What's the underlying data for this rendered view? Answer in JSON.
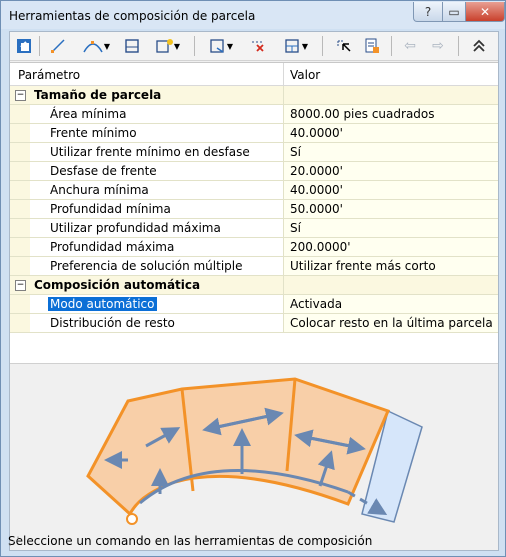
{
  "window": {
    "title": "Herramientas de composición de parcela"
  },
  "grid": {
    "col_param": "Parámetro",
    "col_value": "Valor",
    "categories": [
      {
        "name": "Tamaño de parcela",
        "rows": [
          {
            "label": "Área mínima",
            "value": "8000.00 pies cuadrados"
          },
          {
            "label": "Frente mínimo",
            "value": "40.0000'"
          },
          {
            "label": "Utilizar frente mínimo en desfase",
            "value": "Sí"
          },
          {
            "label": "Desfase de frente",
            "value": "20.0000'"
          },
          {
            "label": "Anchura mínima",
            "value": "40.0000'"
          },
          {
            "label": "Profundidad mínima",
            "value": "50.0000'"
          },
          {
            "label": "Utilizar profundidad máxima",
            "value": "Sí"
          },
          {
            "label": "Profundidad máxima",
            "value": "200.0000'"
          },
          {
            "label": "Preferencia de solución múltiple",
            "value": "Utilizar frente más corto"
          }
        ]
      },
      {
        "name": "Composición automática",
        "rows": [
          {
            "label": "Modo automático",
            "value": "Activada"
          },
          {
            "label": "Distribución de resto",
            "value": "Colocar resto en la última parcela"
          }
        ]
      }
    ]
  },
  "status": {
    "text": "Seleccione un comando en las herramientas de composición"
  },
  "colors": {
    "parcel_fill": "#f8cfa8",
    "parcel_edge": "#f39228",
    "remainder_fill": "#d6e6fa",
    "arrow": "#6a88b2",
    "selection": "#0b6fd6"
  }
}
